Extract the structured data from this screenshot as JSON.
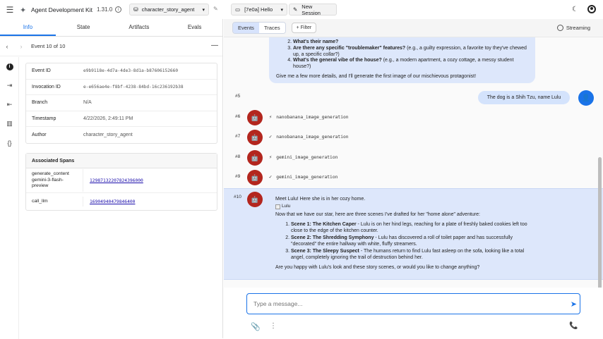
{
  "header": {
    "app_title": "Agent Development Kit",
    "version": "1.31.0",
    "agent": "character_story_agent",
    "session": "[7e0a] Hello",
    "new_session": "New Session"
  },
  "left": {
    "tabs": [
      "Info",
      "State",
      "Artifacts",
      "Evals"
    ],
    "event_label": "Event 10 of 10",
    "meta": [
      {
        "k": "Event ID",
        "v": "e9b9118e-4d7a-4de3-8d1a-b87606152660",
        "mono": true
      },
      {
        "k": "Invocation ID",
        "v": "e-e656ae4e-f8bf-4238-84bd-16c236192b38",
        "mono": true
      },
      {
        "k": "Branch",
        "v": "N/A",
        "mono": false
      },
      {
        "k": "Timestamp",
        "v": "4/22/2026, 2:49:11 PM",
        "mono": false
      },
      {
        "k": "Author",
        "v": "character_story_agent",
        "mono": false
      }
    ],
    "spans_header": "Associated Spans",
    "spans": [
      {
        "k": "generate_content gemini-3-flash-preview",
        "v": "12987132207824396000"
      },
      {
        "k": "call_llm",
        "v": "16904940479846400"
      }
    ]
  },
  "right": {
    "tabs": [
      "Events",
      "Traces"
    ],
    "filter": "+ Filter",
    "streaming": "Streaming",
    "top_bubble": {
      "items": [
        {
          "bold": "What's their name?",
          "rest": ""
        },
        {
          "bold": "Are there any specific \"troublemaker\" features?",
          "rest": " (e.g., a guilty expression, a favorite toy they've chewed up, a specific collar?)"
        },
        {
          "bold": "What's the general vibe of the house?",
          "rest": " (e.g., a modern apartment, a cozy cottage, a messy student house?)"
        }
      ],
      "footer": "Give me a few more details, and I'll generate the first image of our mischievous protagonist!"
    },
    "events": {
      "e5": {
        "num": "#5",
        "text": "The dog is a Shih Tzu, name Lulu"
      },
      "e6": {
        "num": "#6",
        "tool": "nanobanana_image_generation",
        "status": "⚡"
      },
      "e7": {
        "num": "#7",
        "tool": "nanobanana_image_generation",
        "status": "✓"
      },
      "e8": {
        "num": "#8",
        "tool": "gemini_image_generation",
        "status": "⚡"
      },
      "e9": {
        "num": "#9",
        "tool": "gemini_image_generation",
        "status": "✓"
      },
      "e10": {
        "num": "#10",
        "intro": "Meet Lulu! Here she is in her cozy home.",
        "img_alt": "Lulu",
        "lead": "Now that we have our star, here are three scenes I've drafted for her \"home alone\" adventure:",
        "scenes": [
          {
            "bold": "Scene 1: The Kitchen Caper",
            "rest": " - Lulu is on her hind legs, reaching for a plate of freshly baked cookies left too close to the edge of the kitchen counter."
          },
          {
            "bold": "Scene 2: The Shredding Symphony",
            "rest": " - Lulu has discovered a roll of toilet paper and has successfully \"decorated\" the entire hallway with white, fluffy streamers."
          },
          {
            "bold": "Scene 3: The Sleepy Suspect",
            "rest": " - The humans return to find Lulu fast asleep on the sofa, looking like a total angel, completely ignoring the trail of destruction behind her."
          }
        ],
        "closing": "Are you happy with Lulu's look and these story scenes, or would you like to change anything?"
      }
    },
    "composer_placeholder": "Type a message..."
  }
}
